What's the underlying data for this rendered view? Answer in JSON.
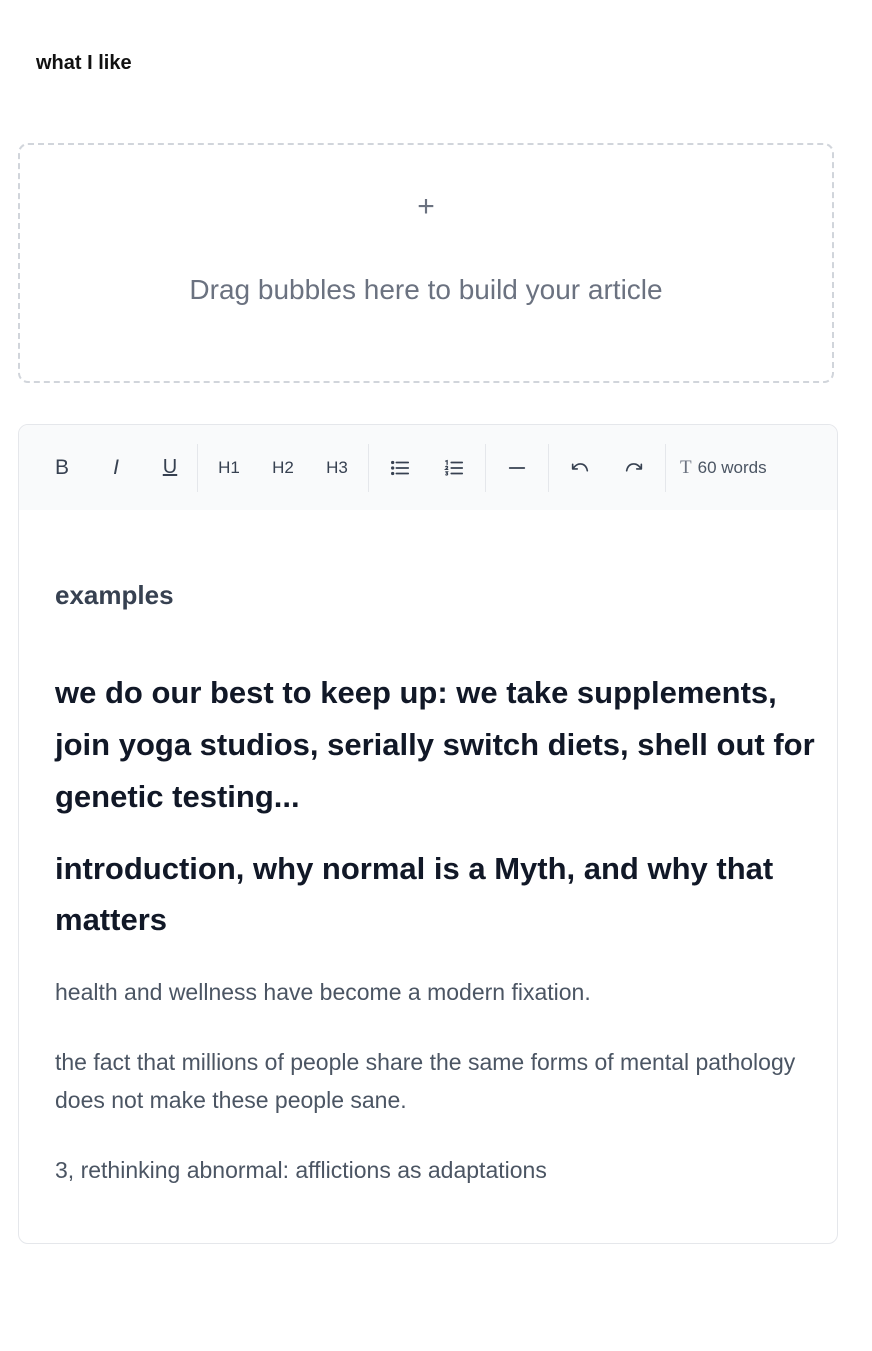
{
  "page": {
    "title": "what I like"
  },
  "dropzone": {
    "plus": "+",
    "hint": "Drag bubbles here to build your article"
  },
  "toolbar": {
    "bold": "B",
    "italic": "I",
    "underline": "U",
    "h1": "H1",
    "h2": "H2",
    "h3": "H3",
    "word_count": "60 words",
    "word_count_icon": "T",
    "icons": [
      "bold-icon",
      "italic-icon",
      "underline-icon",
      "bullet-list-icon",
      "numbered-list-icon",
      "horizontal-rule-icon",
      "undo-icon",
      "redo-icon",
      "text-icon"
    ]
  },
  "content": {
    "heading_examples": "examples",
    "heading_1": "we do our best to keep up: we take supplements, join yoga studios, serially switch diets, shell out for genetic testing...",
    "heading_2": "introduction, why normal is a Myth, and why that matters",
    "paragraph_1": "health and wellness have become a modern fixation.",
    "paragraph_2": "the fact that millions of people share the same forms of mental pathology does not make these people sane.",
    "paragraph_3": "3, rethinking abnormal: afflictions as adaptations"
  },
  "colors": {
    "text_dark": "#111827",
    "text_muted": "#4b5563",
    "border": "#e5e7eb",
    "toolbar_bg": "#f9fafb",
    "dashed_border": "#d1d5db"
  }
}
